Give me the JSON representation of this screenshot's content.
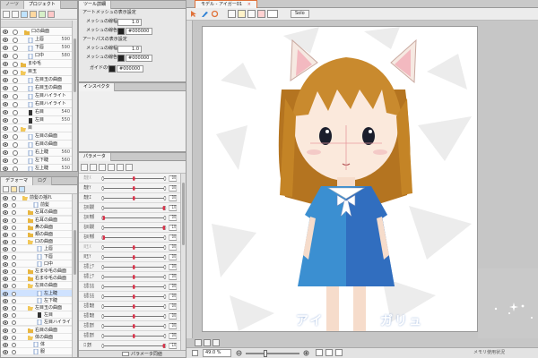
{
  "left_top_panel": {
    "tabs": [
      "ノーツ",
      "プロジェクト"
    ],
    "rows": [
      {
        "indent": 26,
        "icon": "folder",
        "label": "口の曲面",
        "value": ""
      },
      {
        "indent": 30,
        "icon": "art",
        "label": "上唇",
        "value": "590"
      },
      {
        "indent": 30,
        "icon": "art",
        "label": "下唇",
        "value": "590"
      },
      {
        "indent": 30,
        "icon": "art",
        "label": "口中",
        "value": "580"
      },
      {
        "indent": 22,
        "icon": "folder",
        "label": "まゆ毛",
        "value": ""
      },
      {
        "indent": 22,
        "icon": "folder-open",
        "label": "目玉",
        "value": ""
      },
      {
        "indent": 30,
        "icon": "art",
        "label": "左目玉の曲面",
        "value": ""
      },
      {
        "indent": 30,
        "icon": "art",
        "label": "右目玉の曲面",
        "value": ""
      },
      {
        "indent": 30,
        "icon": "art",
        "label": "左目ハイライト",
        "value": ""
      },
      {
        "indent": 30,
        "icon": "art",
        "label": "右目ハイライト",
        "value": ""
      },
      {
        "indent": 30,
        "icon": "art-dark",
        "label": "右目",
        "value": "540"
      },
      {
        "indent": 30,
        "icon": "art-dark",
        "label": "左目",
        "value": "550"
      },
      {
        "indent": 22,
        "icon": "folder-open",
        "label": "目",
        "value": ""
      },
      {
        "indent": 30,
        "icon": "art",
        "label": "左目の曲面",
        "value": ""
      },
      {
        "indent": 30,
        "icon": "art",
        "label": "右目の曲面",
        "value": ""
      },
      {
        "indent": 30,
        "icon": "art",
        "label": "右上睫",
        "value": "560"
      },
      {
        "indent": 30,
        "icon": "art",
        "label": "左下睫",
        "value": "560"
      },
      {
        "indent": 30,
        "icon": "art",
        "label": "左上睫",
        "value": "530"
      }
    ]
  },
  "tool_panel": {
    "tab": "ツール詳細",
    "section1_title": "アートメッシュの表示設定",
    "mesh_width_label": "メッシュの線幅",
    "mesh_width_value": "1.0",
    "mesh_color_label": "メッシュの線色",
    "mesh_color_value": "#000000",
    "section2_title": "アートパスの表示設定",
    "mesh2_width_label": "メッシュの線幅",
    "mesh2_width_value": "1.0",
    "mesh2_color_label": "メッシュの線色",
    "mesh2_color_value": "#000000",
    "guide_label": "ガイドの色",
    "guide_value": "#000000"
  },
  "inspector_panel": {
    "tab": "インスペクタ"
  },
  "params_panel": {
    "tab": "パラメータ",
    "rows": [
      {
        "label": "角度 X",
        "value": "0.0",
        "pos": 0.5,
        "faded": true
      },
      {
        "label": "角度 Y",
        "value": "0.0",
        "pos": 0.5,
        "faded": false
      },
      {
        "label": "角度 Z",
        "value": "0.0",
        "pos": 0.5,
        "faded": false
      },
      {
        "label": "左目 開閉",
        "value": "1.0",
        "pos": 1.0,
        "faded": false
      },
      {
        "label": "左目 笑顔",
        "value": "0.0",
        "pos": 0.0,
        "faded": false
      },
      {
        "label": "右目 開閉",
        "value": "1.0",
        "pos": 1.0,
        "faded": false
      },
      {
        "label": "右目 笑顔",
        "value": "0.0",
        "pos": 0.0,
        "faded": false
      },
      {
        "label": "目玉 X",
        "value": "0.0",
        "pos": 0.5,
        "faded": true
      },
      {
        "label": "目玉 Y",
        "value": "0.0",
        "pos": 0.5,
        "faded": false
      },
      {
        "label": "左眉 上下",
        "value": "0.0",
        "pos": 0.5,
        "faded": false
      },
      {
        "label": "右眉 上下",
        "value": "0.0",
        "pos": 0.5,
        "faded": false
      },
      {
        "label": "左眉 左右",
        "value": "0.0",
        "pos": 0.5,
        "faded": false
      },
      {
        "label": "右眉 左右",
        "value": "0.0",
        "pos": 0.5,
        "faded": false
      },
      {
        "label": "左眉 角度",
        "value": "0.0",
        "pos": 0.5,
        "faded": false
      },
      {
        "label": "右眉 角度",
        "value": "0.0",
        "pos": 0.5,
        "faded": false
      },
      {
        "label": "左眉 変形",
        "value": "0.0",
        "pos": 0.5,
        "faded": false
      },
      {
        "label": "右眉 変形",
        "value": "0.0",
        "pos": 0.5,
        "faded": false
      },
      {
        "label": "口 変形",
        "value": "1.0",
        "pos": 1.0,
        "faded": false
      }
    ],
    "footer_label": "パラメータ同値"
  },
  "deformer_panel": {
    "tabs": [
      "デフォーマ",
      "ログ"
    ],
    "rows": [
      {
        "indent": 24,
        "icon": "folder-open",
        "label": "前髪の揺れ",
        "sel": false
      },
      {
        "indent": 36,
        "icon": "art",
        "label": "前髪",
        "sel": false
      },
      {
        "indent": 30,
        "icon": "folder",
        "label": "左耳の曲面",
        "sel": false
      },
      {
        "indent": 30,
        "icon": "folder",
        "label": "右耳の曲面",
        "sel": false
      },
      {
        "indent": 30,
        "icon": "folder",
        "label": "鼻の曲面",
        "sel": false
      },
      {
        "indent": 30,
        "icon": "folder",
        "label": "頬の曲面",
        "sel": false
      },
      {
        "indent": 30,
        "icon": "folder-open",
        "label": "口の曲面",
        "sel": false
      },
      {
        "indent": 40,
        "icon": "art",
        "label": "上唇",
        "sel": false
      },
      {
        "indent": 40,
        "icon": "art",
        "label": "下唇",
        "sel": false
      },
      {
        "indent": 40,
        "icon": "art",
        "label": "口中",
        "sel": false
      },
      {
        "indent": 30,
        "icon": "folder",
        "label": "左まゆ毛の曲面",
        "sel": false
      },
      {
        "indent": 30,
        "icon": "folder",
        "label": "右まゆ毛の曲面",
        "sel": false
      },
      {
        "indent": 30,
        "icon": "folder-open",
        "label": "左目の曲面",
        "sel": false
      },
      {
        "indent": 40,
        "icon": "art",
        "label": "左上睫",
        "sel": true
      },
      {
        "indent": 40,
        "icon": "art",
        "label": "左下睫",
        "sel": false
      },
      {
        "indent": 30,
        "icon": "folder-open",
        "label": "左目玉の曲面",
        "sel": false
      },
      {
        "indent": 40,
        "icon": "art-dark",
        "label": "左目",
        "sel": false
      },
      {
        "indent": 40,
        "icon": "art",
        "label": "左目ハイライト",
        "sel": false
      },
      {
        "indent": 30,
        "icon": "folder",
        "label": "右目の曲面",
        "sel": false
      },
      {
        "indent": 30,
        "icon": "folder-open",
        "label": "体の曲面",
        "sel": false
      },
      {
        "indent": 36,
        "icon": "art",
        "label": "体",
        "sel": false
      },
      {
        "indent": 36,
        "icon": "art",
        "label": "服",
        "sel": false
      }
    ]
  },
  "canvas_window": {
    "tab_label": "モデル - アイガー01",
    "toolbar_button": "Solo",
    "watermark_left": "アイ",
    "watermark_right": "ガリュ",
    "zoom": "49.0 %",
    "status_right": "メモリ使用状況"
  },
  "colors": {
    "accent_dot": "#d9334a",
    "hair": "#c98a2e",
    "dress": "#3b8fd1",
    "selection": "#cfe2ff"
  }
}
